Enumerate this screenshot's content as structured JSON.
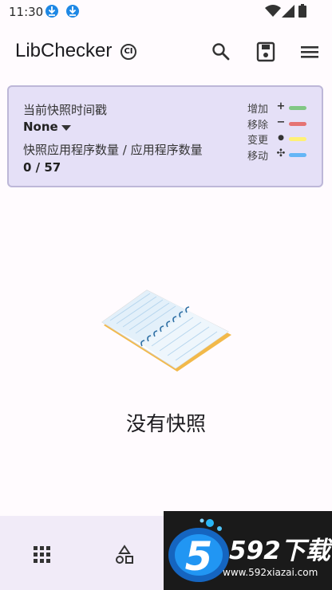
{
  "status_bar": {
    "time": "11:30"
  },
  "app_bar": {
    "title": "LibChecker",
    "badge": "CI"
  },
  "snapshot_card": {
    "timestamp_label": "当前快照时间戳",
    "timestamp_value": "None",
    "count_label": "快照应用程序数量 / 应用程序数量",
    "count_value": "0 / 57",
    "legend": [
      {
        "label": "增加",
        "symbol": "+",
        "color": "#81c784"
      },
      {
        "label": "移除",
        "symbol": "−",
        "color": "#e57373"
      },
      {
        "label": "变更",
        "symbol": "●",
        "color": "#fff176"
      },
      {
        "label": "移动",
        "symbol": "✣",
        "color": "#64b5f6"
      }
    ]
  },
  "empty_state": {
    "text": "没有快照"
  },
  "watermark": {
    "brand": "592下载",
    "digit": "5",
    "url": "www.592xiazai.com"
  },
  "colors": {
    "card_bg": "#e5e0f7",
    "bottom_nav_bg": "#f1ebf8",
    "download_icon": "#1e88e5"
  }
}
